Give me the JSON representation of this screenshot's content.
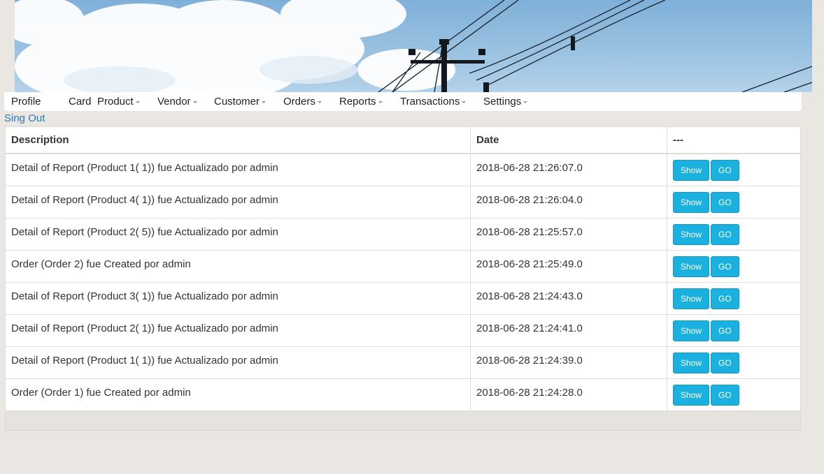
{
  "nav": {
    "items": [
      {
        "label": "Profile",
        "dropdown": false
      },
      {
        "label": "Card",
        "dropdown": false
      },
      {
        "label": "Product",
        "dropdown": true
      },
      {
        "label": "Vendor",
        "dropdown": true
      },
      {
        "label": "Customer",
        "dropdown": true
      },
      {
        "label": "Orders",
        "dropdown": true
      },
      {
        "label": "Reports",
        "dropdown": true
      },
      {
        "label": "Transactions",
        "dropdown": true
      },
      {
        "label": "Settings",
        "dropdown": true
      }
    ]
  },
  "signout_label": "Sing Out",
  "table": {
    "headers": [
      "Description",
      "Date",
      "---"
    ],
    "show_label": "Show",
    "go_label": "GO",
    "rows": [
      {
        "description": "Detail of Report (Product 1( 1)) fue Actualizado por admin",
        "date": "2018-06-28 21:26:07.0"
      },
      {
        "description": "Detail of Report (Product 4( 1)) fue Actualizado por admin",
        "date": "2018-06-28 21:26:04.0"
      },
      {
        "description": "Detail of Report (Product 2( 5)) fue Actualizado por admin",
        "date": "2018-06-28 21:25:57.0"
      },
      {
        "description": "Order (Order 2) fue Created por admin",
        "date": "2018-06-28 21:25:49.0"
      },
      {
        "description": "Detail of Report (Product 3( 1)) fue Actualizado por admin",
        "date": "2018-06-28 21:24:43.0"
      },
      {
        "description": "Detail of Report (Product 2( 1)) fue Actualizado por admin",
        "date": "2018-06-28 21:24:41.0"
      },
      {
        "description": "Detail of Report (Product 1( 1)) fue Actualizado por admin",
        "date": "2018-06-28 21:24:39.0"
      },
      {
        "description": "Order (Order 1) fue Created por admin",
        "date": "2018-06-28 21:24:28.0"
      }
    ]
  },
  "colors": {
    "button": "#1ab1e0",
    "link": "#2a7ab8",
    "page_background": "#eae7e2"
  }
}
